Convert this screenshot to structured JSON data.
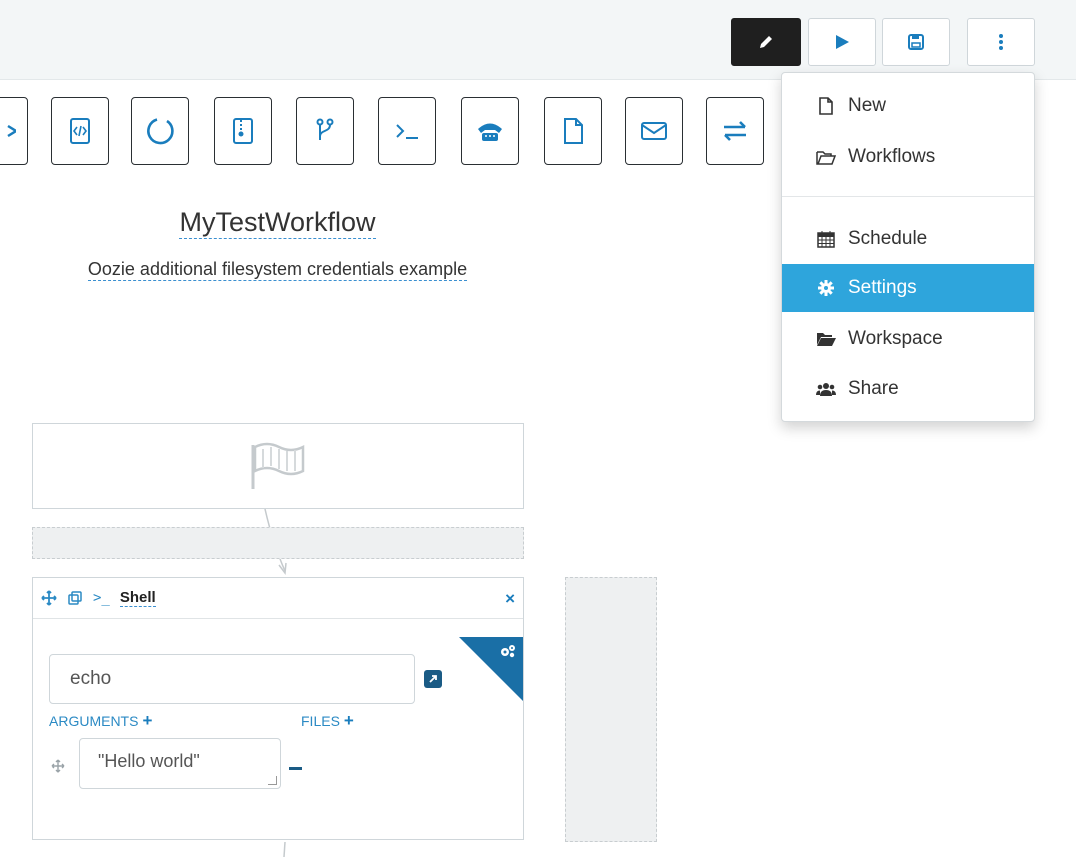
{
  "toolbar": {
    "edit_icon": "pencil-icon",
    "run_icon": "play-icon",
    "save_icon": "floppy-icon",
    "more_icon": "vertical-ellipsis-icon"
  },
  "palette": {
    "items": [
      {
        "icon": "partial-icon"
      },
      {
        "icon": "code-file-icon"
      },
      {
        "icon": "circle-icon"
      },
      {
        "icon": "zip-file-icon"
      },
      {
        "icon": "branch-icon"
      },
      {
        "icon": "terminal-icon"
      },
      {
        "icon": "phone-icon"
      },
      {
        "icon": "file-icon"
      },
      {
        "icon": "envelope-icon"
      },
      {
        "icon": "exchange-icon"
      }
    ]
  },
  "workflow": {
    "title": "MyTestWorkflow",
    "description": "Oozie additional filesystem credentials example"
  },
  "shell_node": {
    "terminal_label": ">_",
    "name": "Shell",
    "close": "×",
    "command_value": "echo",
    "arguments_label": "ARGUMENTS",
    "files_label": "FILES",
    "plus": "+",
    "argument_value": "\"Hello world\""
  },
  "menu": {
    "items": [
      {
        "label": "New",
        "icon": "file-icon"
      },
      {
        "label": "Workflows",
        "icon": "folder-open-icon"
      },
      {
        "label": "Schedule",
        "icon": "calendar-icon"
      },
      {
        "label": "Settings",
        "icon": "gear-icon",
        "active": true
      },
      {
        "label": "Workspace",
        "icon": "folder-icon"
      },
      {
        "label": "Share",
        "icon": "users-icon"
      }
    ]
  },
  "colors": {
    "accent": "#2ea5dc",
    "link": "#2b8ac4",
    "dark_button": "#1f1f1f",
    "corner": "#1a6fa6"
  }
}
